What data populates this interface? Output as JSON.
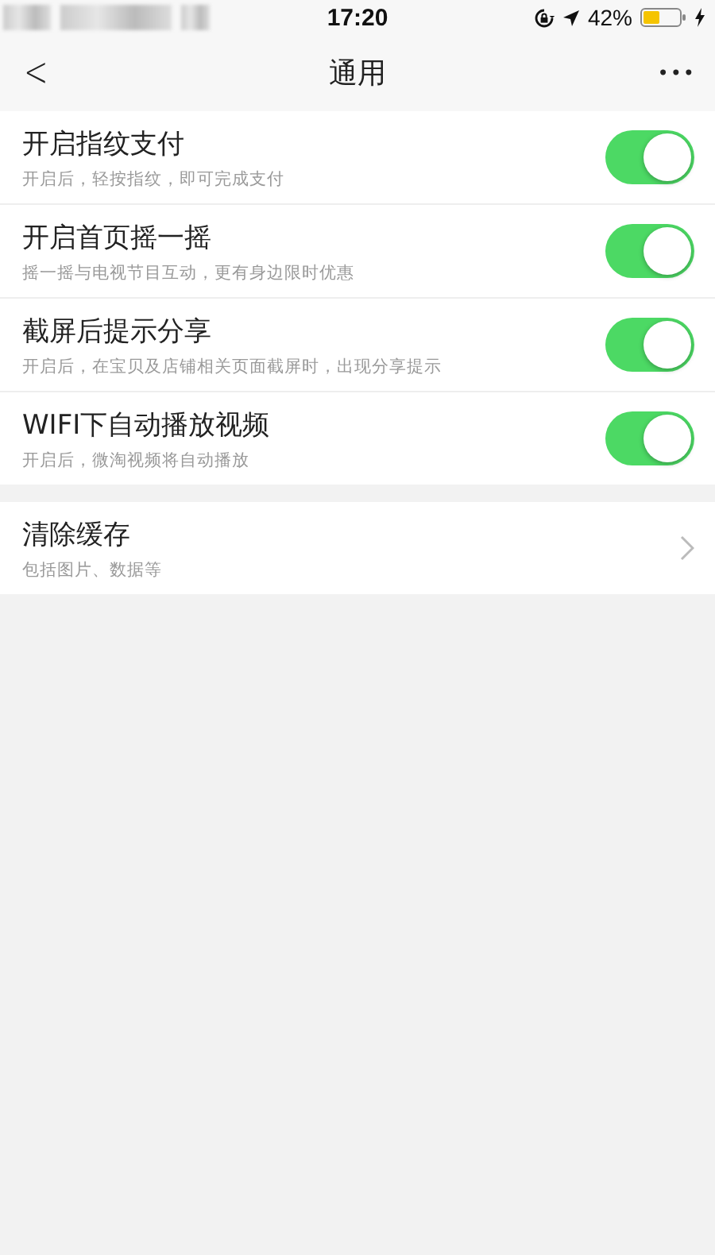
{
  "status_bar": {
    "time": "17:20",
    "battery_percent": "42%"
  },
  "nav_bar": {
    "back": "<",
    "title": "通用",
    "more": "•••"
  },
  "groups": [
    {
      "items": [
        {
          "kind": "toggle",
          "title": "开启指纹支付",
          "subtitle": "开启后，轻按指纹，即可完成支付",
          "on": true
        },
        {
          "kind": "toggle",
          "title": "开启首页摇一摇",
          "subtitle": "摇一摇与电视节目互动，更有身边限时优惠",
          "on": true
        },
        {
          "kind": "toggle",
          "title": "截屏后提示分享",
          "subtitle": "开启后，在宝贝及店铺相关页面截屏时，出现分享提示",
          "on": true
        },
        {
          "kind": "toggle",
          "title": "WIFI下自动播放视频",
          "subtitle": "开启后，微淘视频将自动播放",
          "on": true
        }
      ]
    },
    {
      "items": [
        {
          "kind": "link",
          "title": "清除缓存",
          "subtitle": "包括图片、数据等"
        }
      ]
    }
  ]
}
